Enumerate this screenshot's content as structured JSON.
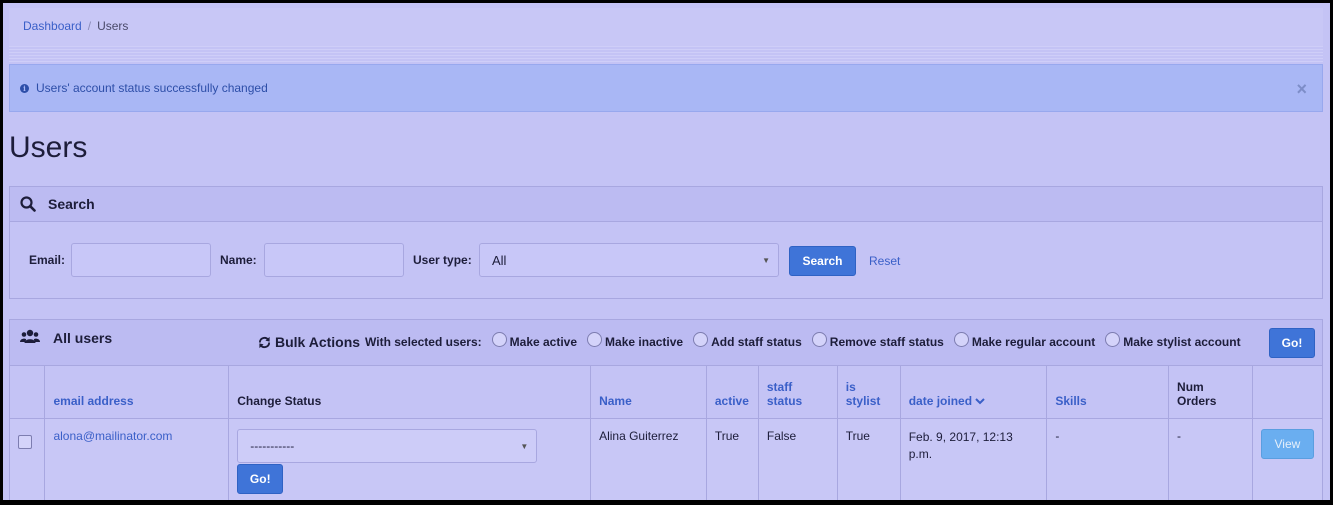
{
  "breadcrumb": {
    "home": "Dashboard",
    "separator": "/",
    "current": "Users"
  },
  "alert": {
    "message": "Users' account status successfully changed",
    "close": "×"
  },
  "page_title": "Users",
  "search": {
    "heading": "Search",
    "email_label": "Email:",
    "email_value": "",
    "name_label": "Name:",
    "name_value": "",
    "user_type_label": "User type:",
    "user_type_value": "All",
    "search_button": "Search",
    "reset_link": "Reset"
  },
  "users_panel": {
    "heading": "All users",
    "bulk_title": "Bulk Actions",
    "bulk_prefix": "With selected users:",
    "actions": [
      "Make active",
      "Make inactive",
      "Add staff status",
      "Remove staff status",
      "Make regular account",
      "Make stylist account"
    ],
    "go_button": "Go!"
  },
  "table": {
    "headers": {
      "email": "email address",
      "change_status": "Change Status",
      "name": "Name",
      "active": "active",
      "staff_status_1": "staff",
      "staff_status_2": "status",
      "is_stylist_1": "is",
      "is_stylist_2": "stylist",
      "date_joined": "date joined",
      "skills": "Skills",
      "num_orders_1": "Num",
      "num_orders_2": "Orders"
    },
    "rows": [
      {
        "email": "alona@mailinator.com",
        "status_select": "-----------",
        "go": "Go!",
        "name": "Alina Guiterrez",
        "active": "True",
        "staff_status": "False",
        "is_stylist": "True",
        "date_joined_1": "Feb. 9, 2017, 12:13",
        "date_joined_2": "p.m.",
        "skills": "-",
        "num_orders": "-",
        "view": "View"
      }
    ]
  },
  "colors": {
    "background": "#c4c3f5",
    "accent": "#3f74d8",
    "link": "#3a5fc8",
    "alert": "#a9b7f5"
  }
}
